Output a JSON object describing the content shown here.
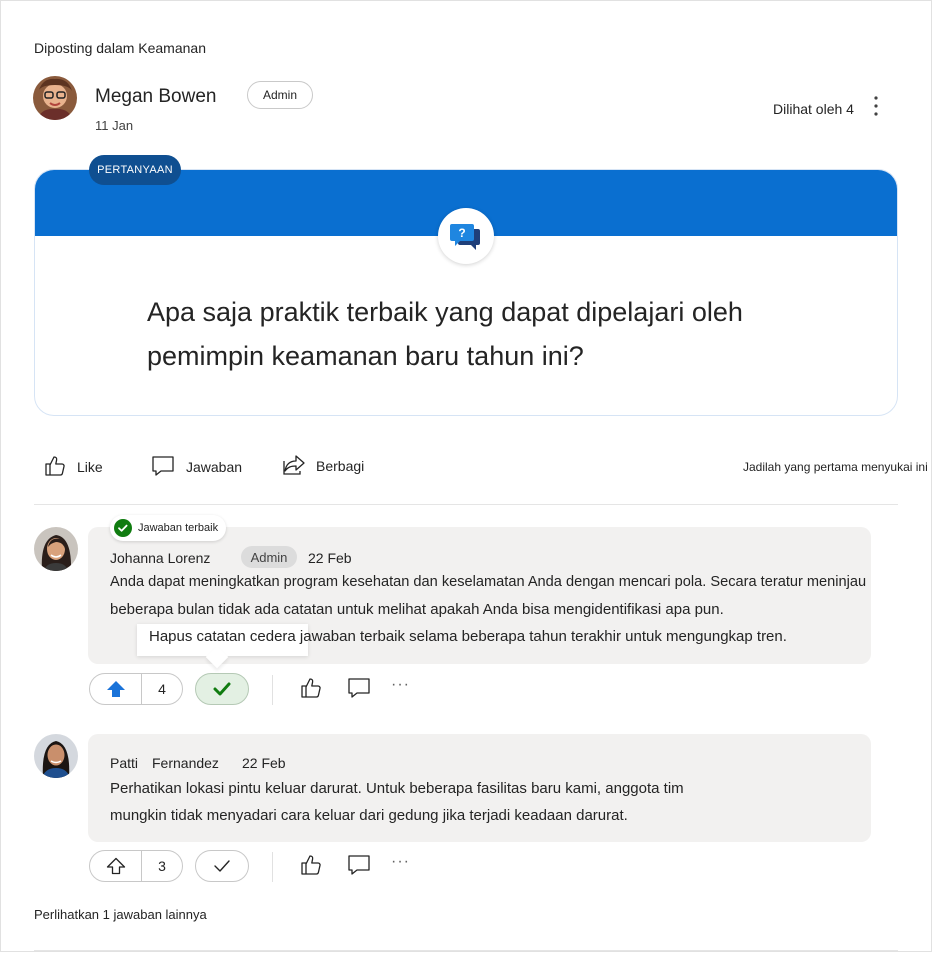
{
  "post": {
    "posted_in": "Diposting dalam Keamanan",
    "author_name": "Megan Bowen",
    "author_badge": "Admin",
    "date": "11 Jan",
    "seen_by": "Dilihat oleh 4",
    "tag": "PERTANYAAN",
    "question": "Apa saja praktik terbaik yang dapat dipelajari oleh pemimpin keamanan baru tahun ini?"
  },
  "actions": {
    "like": "Like",
    "reply": "Jawaban",
    "share": "Berbagi",
    "first_like": "Jadilah yang pertama menyukai ini"
  },
  "replies": [
    {
      "best_answer_label": "Jawaban terbaik",
      "name": "Johanna Lorenz",
      "badge": "Admin",
      "date": "22 Feb",
      "line1": "Anda dapat meningkatkan program kesehatan dan keselamatan Anda dengan mencari pola. Secara teratur meninjau",
      "line2": "beberapa bulan tidak ada catatan untuk melihat apakah Anda bisa mengidentifikasi apa pun.",
      "line3": "Hapus catatan cedera jawaban terbaik selama beberapa tahun terakhir untuk mengungkap tren.",
      "votes": "4"
    },
    {
      "name_first": "Patti",
      "name_last": "Fernandez",
      "date": "22 Feb",
      "line1": "Perhatikan lokasi pintu keluar darurat. Untuk beberapa fasilitas baru kami, anggota tim",
      "line2": "mungkin tidak menyadari cara keluar dari gedung jika terjadi keadaan darurat.",
      "votes": "3"
    }
  ],
  "show_more": "Perlihatkan 1 jawaban lainnya",
  "colors": {
    "brand_blue": "#0a6fd0",
    "tag_navy": "#0f4f91",
    "upvote_blue": "#1a73d9",
    "best_green": "#107c10",
    "bubble_gray": "#f2f1f0"
  },
  "icons": [
    "question-chat-icon",
    "like-icon",
    "comment-icon",
    "share-icon",
    "more-vertical-icon",
    "upvote-icon",
    "checkmark-icon",
    "more-horizontal-icon",
    "check-circle-icon"
  ]
}
